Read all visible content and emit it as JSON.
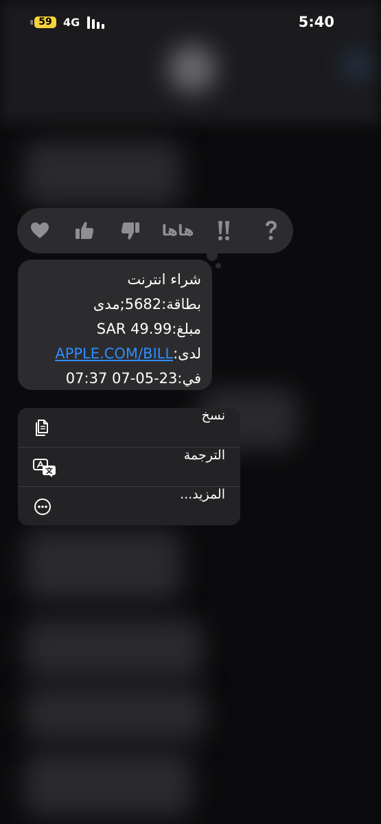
{
  "status_bar": {
    "battery": "59",
    "network": "4G",
    "time": "5:40"
  },
  "reactions": {
    "items": [
      {
        "name": "heart-icon"
      },
      {
        "name": "thumbs-up-icon"
      },
      {
        "name": "thumbs-down-icon"
      },
      {
        "name": "haha",
        "label": "هاها"
      },
      {
        "name": "exclamation-icon"
      },
      {
        "name": "question-icon"
      }
    ],
    "color": "#8e8e93"
  },
  "message": {
    "lines": [
      "شراء انترنت",
      "بطاقة:5682;مدى",
      "مبلغ:SAR 49.99"
    ],
    "merchant_prefix": "لدى:",
    "merchant_link": "APPLE.COM/BILL",
    "date_line": "في:23-05-07 07:37"
  },
  "menu": {
    "items": [
      {
        "label": "نسخ",
        "icon": "copy-icon"
      },
      {
        "label": "الترجمة",
        "icon": "translate-icon"
      },
      {
        "label": "المزيد...",
        "icon": "more-icon"
      }
    ]
  },
  "colors": {
    "bubble": "#2c2c2e",
    "link": "#2f8cff",
    "battery": "#f5d23b"
  }
}
